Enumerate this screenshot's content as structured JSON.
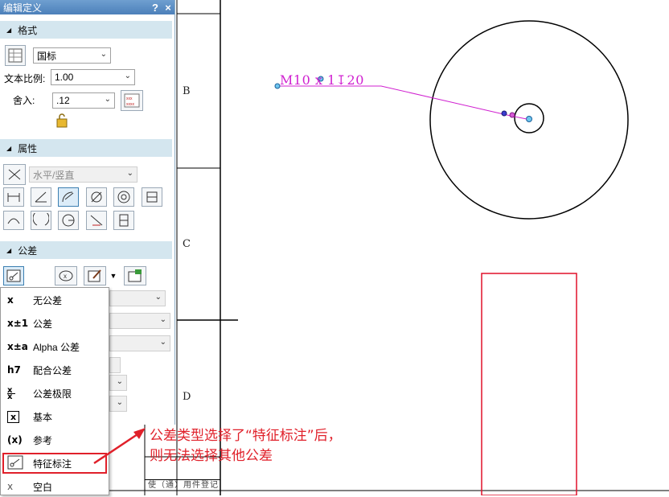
{
  "panel": {
    "title": "编辑定义",
    "help_label": "?",
    "close_label": "×",
    "format_section": {
      "header": "格式",
      "standard_value": "国标",
      "text_scale_label": "文本比例:",
      "text_scale_value": "1.00",
      "rounding_label": "舍入:",
      "rounding_value": ".12"
    },
    "property_section": {
      "header": "属性",
      "orientation_value": "水平/竖直"
    },
    "tolerance_section": {
      "header": "公差",
      "menu": [
        {
          "symbol": "x",
          "label": "无公差",
          "icon": "no-tolerance-icon"
        },
        {
          "symbol": "x±1",
          "label": "公差",
          "icon": "tolerance-icon"
        },
        {
          "symbol": "x±a",
          "label": "Alpha 公差",
          "icon": "alpha-tolerance-icon"
        },
        {
          "symbol": "h7",
          "label": "配合公差",
          "icon": "fit-tolerance-icon"
        },
        {
          "symbol": "x/x",
          "label": "公差极限",
          "icon": "limit-tolerance-icon"
        },
        {
          "symbol": "[x]",
          "label": "基本",
          "icon": "basic-icon"
        },
        {
          "symbol": "(x)",
          "label": "参考",
          "icon": "reference-icon"
        },
        {
          "symbol": "feature",
          "label": "特征标注",
          "icon": "feature-callout-icon"
        },
        {
          "symbol": "x",
          "label": "空白",
          "icon": "blank-icon"
        }
      ],
      "selected_index": 7
    }
  },
  "drawing": {
    "zone_letters": [
      "B",
      "C",
      "D"
    ],
    "callout_text": "M10 x 1↧20",
    "title_strip": "使（通）用件登记"
  },
  "annotation": {
    "line1": "公差类型选择了“特征标注”后，",
    "line2": "则无法选择其他公差",
    "color": "#e0202a"
  },
  "colors": {
    "panel_title_bg": "#5a8cc4",
    "section_header_bg": "#d4e6ef",
    "leader_color": "#d020d0",
    "annotation_red": "#e0202a"
  }
}
